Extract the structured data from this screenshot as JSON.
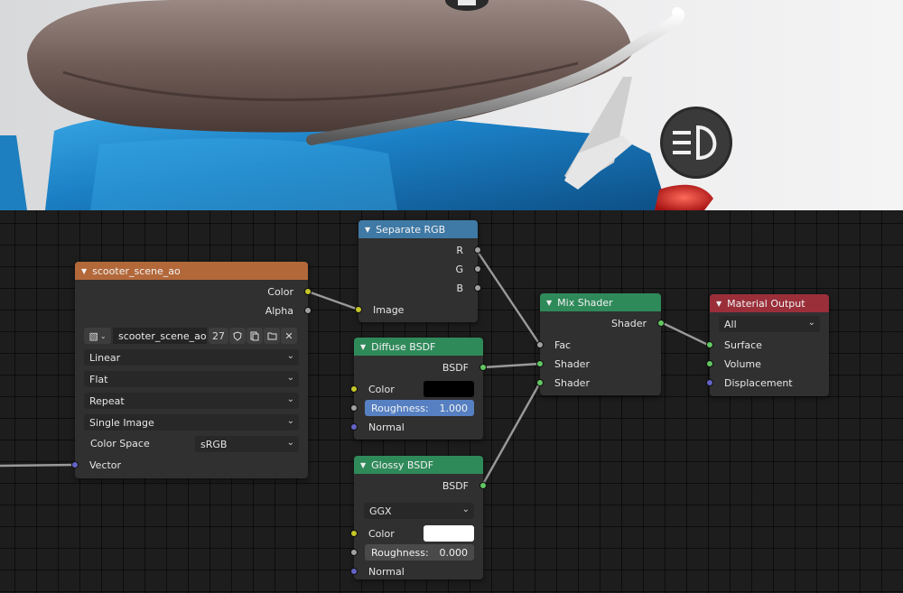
{
  "viewport": {
    "icons": [
      "headlight-icon"
    ]
  },
  "nodes": {
    "image_texture": {
      "title": "scooter_scene_ao",
      "outputs": [
        "Color",
        "Alpha"
      ],
      "image_name": "scooter_scene_ao",
      "users_count": "27",
      "interpolation": "Linear",
      "projection": "Flat",
      "extension": "Repeat",
      "source": "Single Image",
      "color_space_label": "Color Space",
      "color_space": "sRGB",
      "inputs": [
        "Vector"
      ]
    },
    "separate_rgb": {
      "title": "Separate RGB",
      "outputs": [
        "R",
        "G",
        "B"
      ],
      "inputs": [
        "Image"
      ]
    },
    "diffuse": {
      "title": "Diffuse BSDF",
      "outputs": [
        "BSDF"
      ],
      "color_label": "Color",
      "color_value": "#000000",
      "roughness_label": "Roughness:",
      "roughness_value": "1.000",
      "normal_label": "Normal"
    },
    "glossy": {
      "title": "Glossy BSDF",
      "outputs": [
        "BSDF"
      ],
      "distribution": "GGX",
      "color_label": "Color",
      "color_value": "#ffffff",
      "roughness_label": "Roughness:",
      "roughness_value": "0.000",
      "normal_label": "Normal"
    },
    "mix_shader": {
      "title": "Mix Shader",
      "outputs": [
        "Shader"
      ],
      "inputs": [
        "Fac",
        "Shader",
        "Shader"
      ]
    },
    "material_output": {
      "title": "Material Output",
      "target": "All",
      "inputs": [
        "Surface",
        "Volume",
        "Displacement"
      ]
    }
  },
  "colors": {
    "texture_header": "#b3683a",
    "converter_header": "#3f79a5",
    "shader_header": "#2f8a5a",
    "output_header": "#9a2f3a",
    "roughness_active": "#5680c2"
  }
}
